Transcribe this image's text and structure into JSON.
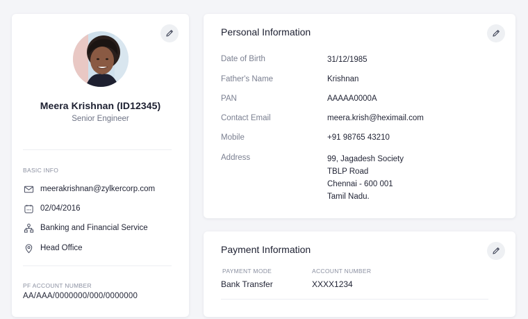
{
  "profile": {
    "name": "Meera Krishnan (ID12345)",
    "role": "Senior Engineer",
    "basic_info_label": "BASIC INFO",
    "email": "meerakrishnan@zylkercorp.com",
    "date": "02/04/2016",
    "department": "Banking and Financial Service",
    "location": "Head Office",
    "pf_label": "PF  ACCOUNT NUMBER",
    "pf_number": "AA/AAA/0000000/000/0000000"
  },
  "personal": {
    "title": "Personal Information",
    "fields": [
      {
        "label": "Date of Birth",
        "value": "31/12/1985"
      },
      {
        "label": "Father's Name",
        "value": "Krishnan"
      },
      {
        "label": "PAN",
        "value": "AAAAA0000A"
      },
      {
        "label": "Contact Email",
        "value": "meera.krish@heximail.com"
      },
      {
        "label": "Mobile",
        "value": "+91 98765 43210"
      }
    ],
    "address_label": "Address",
    "address_lines": [
      "99, Jagadesh Society",
      "TBLP Road",
      "Chennai - 600 001",
      "Tamil Nadu."
    ]
  },
  "payment": {
    "title": "Payment Information",
    "mode_label": "PAYMENT MODE",
    "mode_value": "Bank Transfer",
    "account_label": "ACCOUNT NUMBER",
    "account_value": "XXXX1234"
  },
  "icons": {
    "edit": "pencil-icon",
    "email": "mail-icon",
    "date": "calendar-icon",
    "department": "org-chart-icon",
    "location": "map-pin-icon"
  }
}
